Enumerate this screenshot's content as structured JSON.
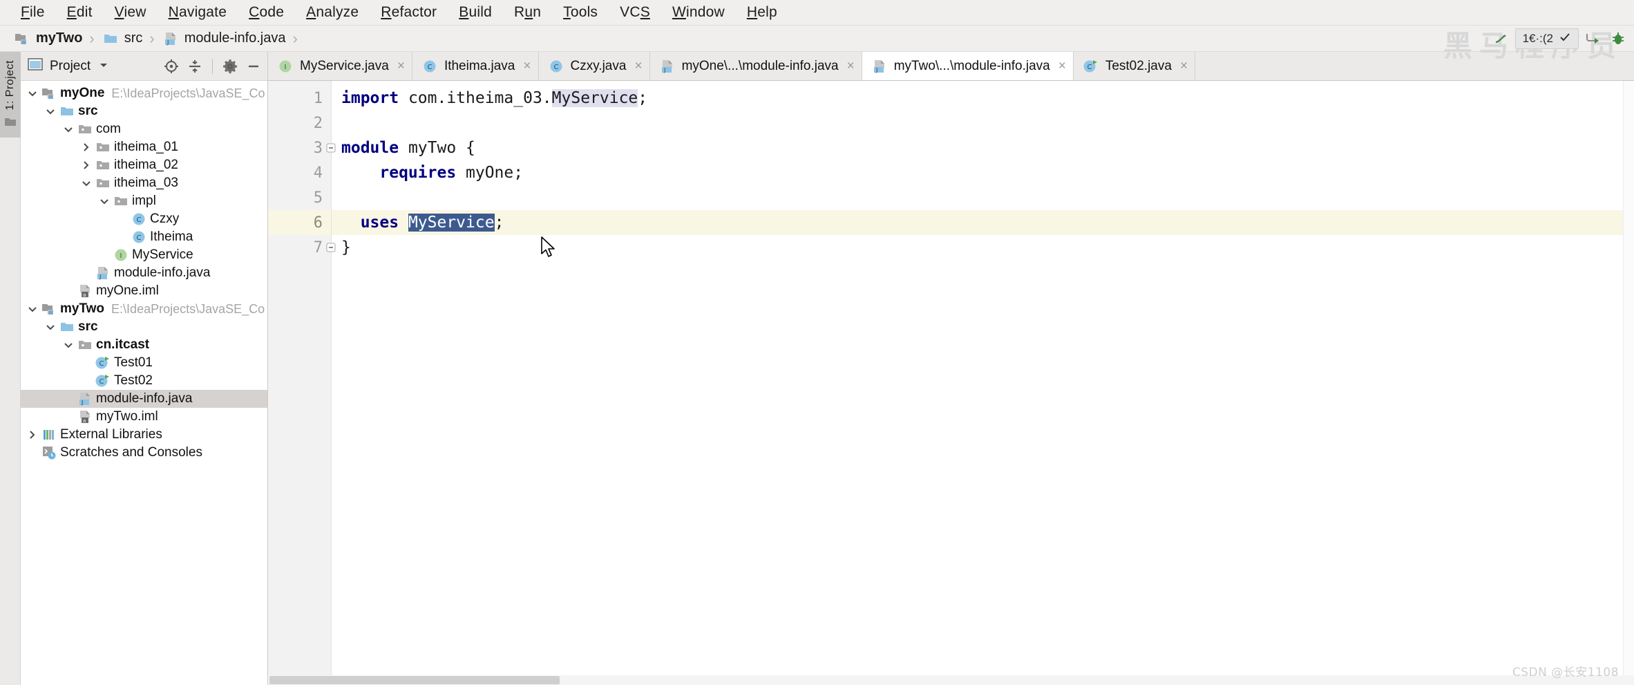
{
  "menubar": {
    "items": [
      {
        "label": "File",
        "mnemonic": "F"
      },
      {
        "label": "Edit",
        "mnemonic": "E"
      },
      {
        "label": "View",
        "mnemonic": "V"
      },
      {
        "label": "Navigate",
        "mnemonic": "N"
      },
      {
        "label": "Code",
        "mnemonic": "C"
      },
      {
        "label": "Analyze",
        "mnemonic": "A"
      },
      {
        "label": "Refactor",
        "mnemonic": "R"
      },
      {
        "label": "Build",
        "mnemonic": "B"
      },
      {
        "label": "Run",
        "mnemonic": "u"
      },
      {
        "label": "Tools",
        "mnemonic": "T"
      },
      {
        "label": "VCS",
        "mnemonic": "S"
      },
      {
        "label": "Window",
        "mnemonic": "W"
      },
      {
        "label": "Help",
        "mnemonic": "H"
      }
    ]
  },
  "breadcrumb": {
    "items": [
      {
        "label": "myTwo",
        "icon": "module-folder-icon",
        "bold": true
      },
      {
        "label": "src",
        "icon": "source-folder-icon",
        "bold": false
      },
      {
        "label": "module-info.java",
        "icon": "module-info-file-icon",
        "bold": false
      }
    ],
    "separator": "›"
  },
  "toolbar": {
    "run_config_label": "1€·:(2",
    "icons": [
      "run-icon",
      "run-config-dropdown",
      "checkmark-icon",
      "run-arrow-icon",
      "debug-bug-icon"
    ],
    "watermark": "黑马程序员"
  },
  "left_strip": {
    "tool_window_label": "1: Project",
    "icon": "project-folder-icon"
  },
  "project_panel": {
    "title": "Project",
    "dropdown_icon": "chevron-down-icon",
    "window_icon": "project-view-icon",
    "actions": [
      "locate-icon",
      "collapse-all-icon",
      "settings-gear-icon",
      "hide-panel-icon"
    ],
    "tree": [
      {
        "indent": 0,
        "arrow": "down",
        "icon": "module-folder-icon",
        "label": "myOne",
        "bold": true,
        "path": "E:\\IdeaProjects\\JavaSE_Co",
        "selected": false
      },
      {
        "indent": 1,
        "arrow": "down",
        "icon": "source-folder-icon",
        "label": "src",
        "bold": true,
        "path": "",
        "selected": false
      },
      {
        "indent": 2,
        "arrow": "down",
        "icon": "package-icon",
        "label": "com",
        "bold": false,
        "path": "",
        "selected": false
      },
      {
        "indent": 3,
        "arrow": "right",
        "icon": "package-icon",
        "label": "itheima_01",
        "bold": false,
        "path": "",
        "selected": false
      },
      {
        "indent": 3,
        "arrow": "right",
        "icon": "package-icon",
        "label": "itheima_02",
        "bold": false,
        "path": "",
        "selected": false
      },
      {
        "indent": 3,
        "arrow": "down",
        "icon": "package-icon",
        "label": "itheima_03",
        "bold": false,
        "path": "",
        "selected": false
      },
      {
        "indent": 4,
        "arrow": "down",
        "icon": "package-icon",
        "label": "impl",
        "bold": false,
        "path": "",
        "selected": false
      },
      {
        "indent": 5,
        "arrow": "none",
        "icon": "class-icon",
        "label": "Czxy",
        "bold": false,
        "path": "",
        "selected": false
      },
      {
        "indent": 5,
        "arrow": "none",
        "icon": "class-icon",
        "label": "Itheima",
        "bold": false,
        "path": "",
        "selected": false
      },
      {
        "indent": 4,
        "arrow": "none",
        "icon": "interface-icon",
        "label": "MyService",
        "bold": false,
        "path": "",
        "selected": false
      },
      {
        "indent": 3,
        "arrow": "none",
        "icon": "module-info-file-icon",
        "label": "module-info.java",
        "bold": false,
        "path": "",
        "selected": false
      },
      {
        "indent": 2,
        "arrow": "none",
        "icon": "iml-file-icon",
        "label": "myOne.iml",
        "bold": false,
        "path": "",
        "selected": false
      },
      {
        "indent": 0,
        "arrow": "down",
        "icon": "module-folder-icon",
        "label": "myTwo",
        "bold": true,
        "path": "E:\\IdeaProjects\\JavaSE_Co",
        "selected": false
      },
      {
        "indent": 1,
        "arrow": "down",
        "icon": "source-folder-icon",
        "label": "src",
        "bold": true,
        "path": "",
        "selected": false
      },
      {
        "indent": 2,
        "arrow": "down",
        "icon": "package-icon",
        "label": "cn.itcast",
        "bold": true,
        "path": "",
        "selected": false
      },
      {
        "indent": 3,
        "arrow": "none",
        "icon": "runnable-class-icon",
        "label": "Test01",
        "bold": false,
        "path": "",
        "selected": false
      },
      {
        "indent": 3,
        "arrow": "none",
        "icon": "runnable-class-icon",
        "label": "Test02",
        "bold": false,
        "path": "",
        "selected": false
      },
      {
        "indent": 2,
        "arrow": "none",
        "icon": "module-info-file-icon",
        "label": "module-info.java",
        "bold": false,
        "path": "",
        "selected": true
      },
      {
        "indent": 2,
        "arrow": "none",
        "icon": "iml-file-icon",
        "label": "myTwo.iml",
        "bold": false,
        "path": "",
        "selected": false
      },
      {
        "indent": 0,
        "arrow": "right",
        "icon": "libraries-icon",
        "label": "External Libraries",
        "bold": false,
        "path": "",
        "selected": false
      },
      {
        "indent": 0,
        "arrow": "none",
        "icon": "scratches-icon",
        "label": "Scratches and Consoles",
        "bold": false,
        "path": "",
        "selected": false
      }
    ]
  },
  "editor": {
    "tabs": [
      {
        "label": "MyService.java",
        "icon": "interface-icon",
        "active": false,
        "close": "×"
      },
      {
        "label": "Itheima.java",
        "icon": "class-icon",
        "active": false,
        "close": "×"
      },
      {
        "label": "Czxy.java",
        "icon": "class-icon",
        "active": false,
        "close": "×"
      },
      {
        "label": "myOne\\...\\module-info.java",
        "icon": "module-info-file-icon",
        "active": false,
        "close": "×"
      },
      {
        "label": "myTwo\\...\\module-info.java",
        "icon": "module-info-file-icon",
        "active": true,
        "close": "×"
      },
      {
        "label": "Test02.java",
        "icon": "runnable-class-icon",
        "active": false,
        "close": "×"
      }
    ],
    "line_numbers": [
      "1",
      "2",
      "3",
      "4",
      "5",
      "6",
      "7"
    ],
    "current_line": 6,
    "lines": [
      {
        "n": 1,
        "segments": [
          {
            "t": "import ",
            "style": "kw"
          },
          {
            "t": "com.itheima_03.",
            "style": "plain"
          },
          {
            "t": "MyService",
            "style": "usage"
          },
          {
            "t": ";",
            "style": "plain"
          }
        ]
      },
      {
        "n": 2,
        "segments": []
      },
      {
        "n": 3,
        "segments": [
          {
            "t": "module ",
            "style": "kw"
          },
          {
            "t": "myTwo {",
            "style": "plain"
          }
        ],
        "fold": "collapse"
      },
      {
        "n": 4,
        "segments": [
          {
            "t": "    requires ",
            "style": "kw"
          },
          {
            "t": "myOne;",
            "style": "plain"
          }
        ]
      },
      {
        "n": 5,
        "segments": []
      },
      {
        "n": 6,
        "segments": [
          {
            "t": "  uses ",
            "style": "kw"
          },
          {
            "t": "MyService",
            "style": "sel"
          },
          {
            "t": ";",
            "style": "plain"
          }
        ],
        "bulb": true
      },
      {
        "n": 7,
        "segments": [
          {
            "t": "}",
            "style": "plain"
          }
        ],
        "fold": "collapse"
      }
    ]
  },
  "footer": {
    "watermark": "CSDN @长安1108"
  },
  "colors": {
    "keyword": "#000080",
    "selection_bg": "#3d5a8f",
    "usage_highlight": "#dfdfef",
    "current_line": "#faf6e4",
    "tree_selected": "#d5d2cf",
    "panel_bg": "#eceae8",
    "editor_bg": "#ffffff"
  }
}
